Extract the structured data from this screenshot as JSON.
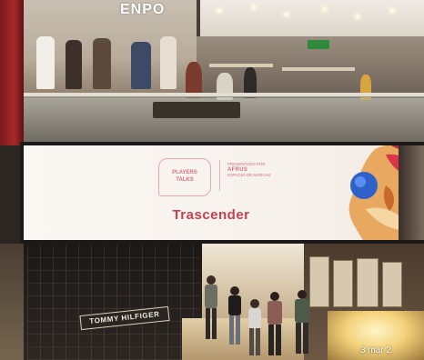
{
  "upper_store": {
    "sign_text": "ENPO"
  },
  "billboard": {
    "logo_line1": "PLAYERS",
    "logo_line2": "TALKS",
    "partner_top": "PRESENTADO POR",
    "partner_main": "AFRUS",
    "partner_sub": "ESPACIO DE MARCAS",
    "headline": "Trascender"
  },
  "lower_store": {
    "sign_text": "TOMMY HILFIGER"
  },
  "watermark": {
    "text": "3 mar 2"
  }
}
